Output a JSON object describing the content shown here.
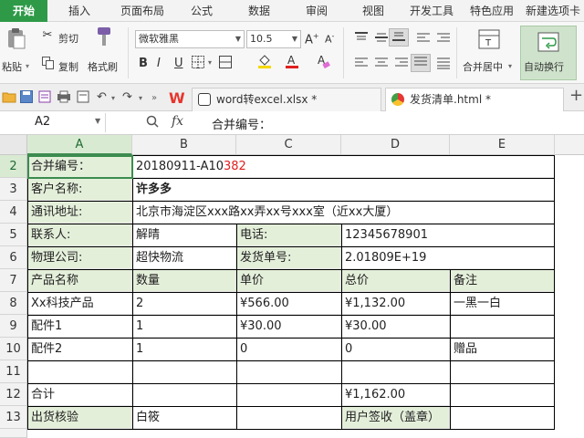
{
  "ribbon_tabs": [
    "开始",
    "插入",
    "页面布局",
    "公式",
    "数据",
    "审阅",
    "视图",
    "开发工具",
    "特色应用",
    "新建选项卡"
  ],
  "ribbon": {
    "paste": "粘贴",
    "cut": "剪切",
    "copy": "复制",
    "format_painter": "格式刷",
    "font_name": "微软雅黑",
    "font_size": "10.5",
    "merge_center": "合并居中",
    "wrap_text": "自动换行"
  },
  "doc_tabs": [
    "word转excel.xlsx *",
    "发货清单.html *"
  ],
  "new_tab": "+",
  "formula_bar": {
    "name_box": "A2",
    "fx": "fx",
    "content": "合并编号："
  },
  "columns": [
    "A",
    "B",
    "C",
    "D",
    "E"
  ],
  "rows": [
    "2",
    "3",
    "4",
    "5",
    "6",
    "7",
    "8",
    "9",
    "10",
    "11",
    "12",
    "13"
  ],
  "sheet": {
    "r2": {
      "a": "合并编号：",
      "b_prefix": "20180911-A10",
      "b_red": "382"
    },
    "r3": {
      "a": "客户名称:",
      "b": "许多多"
    },
    "r4": {
      "a": "通讯地址:",
      "b": "北京市海淀区xxx路xx弄xx号xxx室（近xx大厦）"
    },
    "r5": {
      "a": "联系人:",
      "b": "解晴",
      "c": "电话:",
      "d": "12345678901"
    },
    "r6": {
      "a": "物理公司:",
      "b": "超快物流",
      "c": "发货单号:",
      "d": "2.01809E+19"
    },
    "r7": {
      "a": "产品名称",
      "b": "数量",
      "c": "单价",
      "d": "总价",
      "e": "备注"
    },
    "r8": {
      "a": "Xx科技产品",
      "b": "2",
      "c": "¥566.00",
      "d": "¥1,132.00",
      "e": "一黑一白"
    },
    "r9": {
      "a": "配件1",
      "b": "1",
      "c": "¥30.00",
      "d": "¥30.00"
    },
    "r10": {
      "a": "配件2",
      "b": "1",
      "c": "0",
      "d": "0",
      "e": "赠品"
    },
    "r12": {
      "a": "合计",
      "d": "¥1,162.00"
    },
    "r13": {
      "a": "出货核验",
      "b": "白筱",
      "d": "用户签收（盖章）"
    }
  },
  "colors": {
    "accent": "#2e9a48",
    "selection": "#3c8c4f",
    "shade": "#e4efda",
    "highlight_text": "#e02020"
  }
}
